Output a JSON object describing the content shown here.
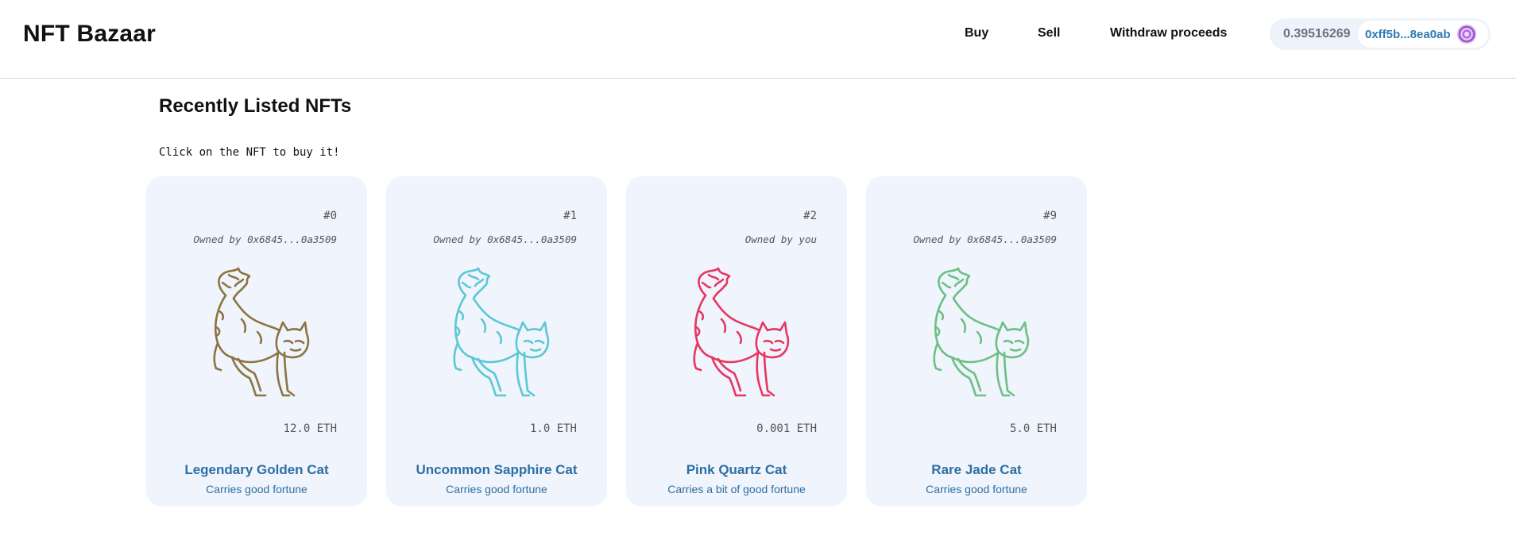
{
  "brand": "NFT Bazaar",
  "nav": {
    "buy": "Buy",
    "sell": "Sell",
    "withdraw": "Withdraw proceeds"
  },
  "wallet": {
    "balance": "0.39516269",
    "address": "0xff5b...8ea0ab",
    "avatar_icon": "identicon-avatar"
  },
  "section": {
    "title": "Recently Listed NFTs",
    "hint": "Click on the NFT to buy it!"
  },
  "cards": [
    {
      "token": "#0",
      "owner": "Owned by 0x6845...0a3509",
      "price": "12.0 ETH",
      "name": "Legendary Golden Cat",
      "desc": "Carries good fortune",
      "color": "#8c7440"
    },
    {
      "token": "#1",
      "owner": "Owned by 0x6845...0a3509",
      "price": "1.0 ETH",
      "name": "Uncommon Sapphire Cat",
      "desc": "Carries good fortune",
      "color": "#5bc8d4"
    },
    {
      "token": "#2",
      "owner": "Owned by you",
      "price": "0.001 ETH",
      "name": "Pink Quartz Cat",
      "desc": "Carries a bit of good fortune",
      "color": "#e8365f"
    },
    {
      "token": "#9",
      "owner": "Owned by 0x6845...0a3509",
      "price": "5.0 ETH",
      "name": "Rare Jade Cat",
      "desc": "Carries good fortune",
      "color": "#6cc084"
    }
  ],
  "icons": {
    "cat": "cat-illustration-icon"
  }
}
